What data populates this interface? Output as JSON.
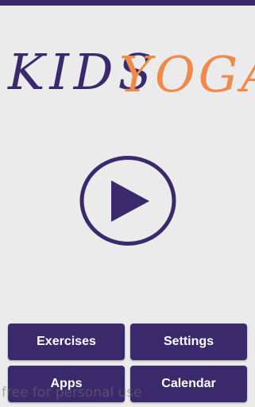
{
  "colors": {
    "primary": "#3a2a6b",
    "accent": "#f08a4b",
    "background": "#ebebeb"
  },
  "logo": {
    "word1": "KIDS",
    "word2": "YOGA"
  },
  "play": {
    "icon": "play-icon"
  },
  "menu": {
    "exercises_label": "Exercises",
    "settings_label": "Settings",
    "apps_label": "Apps",
    "calendar_label": "Calendar"
  },
  "watermark": "free for personal use"
}
